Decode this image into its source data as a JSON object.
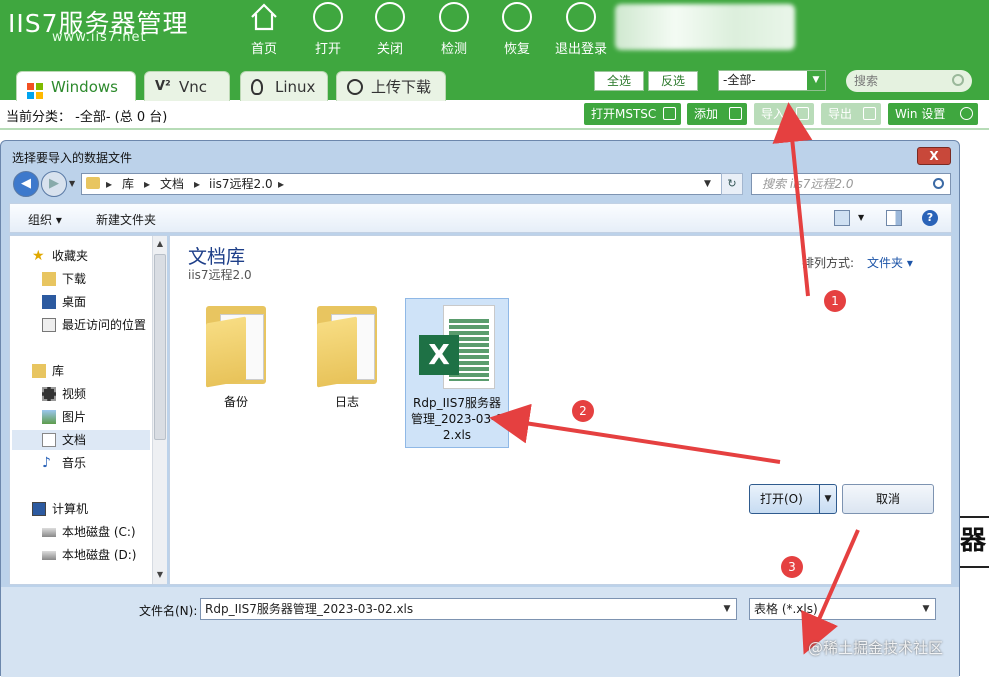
{
  "app": {
    "logo": "IIS7服务器管理",
    "url": "www.iis7.net",
    "nav": [
      "首页",
      "打开",
      "关闭",
      "检测",
      "恢复",
      "退出登录"
    ],
    "tabs": [
      "Windows",
      "Vnc",
      "Linux",
      "上传下载"
    ],
    "select_all": "全选",
    "invert": "反选",
    "category_select": "-全部-",
    "search_placeholder": "搜索",
    "category_text": "当前分类：  -全部- (总 0 台)",
    "toolbar": {
      "mstsc": "打开MSTSC",
      "add": "添加",
      "import": "导入",
      "export": "导出",
      "win_settings": "Win 设置"
    },
    "bg_glyph": "器"
  },
  "dialog": {
    "title": "选择要导入的数据文件",
    "close": "X",
    "breadcrumb": [
      "库",
      "文档",
      "iis7远程2.0"
    ],
    "search_placeholder": "搜索 iis7远程2.0",
    "organize": "组织 ▾",
    "new_folder": "新建文件夹",
    "nav": {
      "favorites": "收藏夹",
      "downloads": "下载",
      "desktop": "桌面",
      "recent": "最近访问的位置",
      "libraries": "库",
      "videos": "视频",
      "pictures": "图片",
      "documents": "文档",
      "music": "音乐",
      "computer": "计算机",
      "disk_c": "本地磁盘 (C:)",
      "disk_d": "本地磁盘 (D:)"
    },
    "library_title": "文档库",
    "library_sub": "iis7远程2.0",
    "sort_label": "排列方式:",
    "sort_value": "文件夹 ▾",
    "files": [
      {
        "name": "备份",
        "type": "folder"
      },
      {
        "name": "日志",
        "type": "folder"
      },
      {
        "name": "Rdp_IIS7服务器管理_2023-03-02.xls",
        "type": "xls",
        "selected": true
      }
    ],
    "file_name_label": "文件名(N):",
    "file_name_value": "Rdp_IIS7服务器管理_2023-03-02.xls",
    "file_type_value": "表格 (*.xls)",
    "open_btn": "打开(O)",
    "cancel_btn": "取消"
  },
  "annotations": [
    "1",
    "2",
    "3"
  ],
  "watermark": "@稀土掘金技术社区",
  "colors": {
    "brand_green": "#3fa73f",
    "arrow_red": "#e54040",
    "dialog_frame": "#bcd2ea"
  }
}
